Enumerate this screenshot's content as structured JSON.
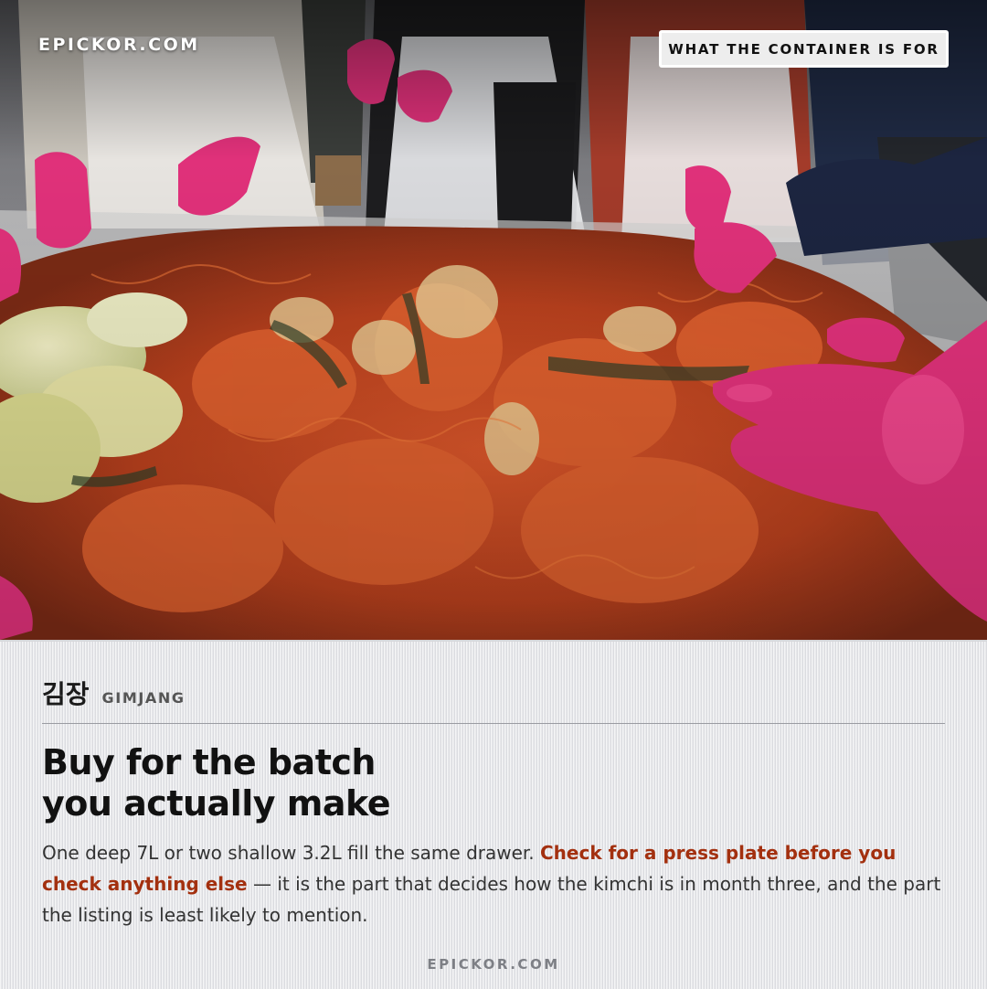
{
  "header": {
    "brand": "EPICKOR.COM",
    "badge": "WHAT THE CONTAINER IS FOR"
  },
  "article": {
    "kicker_ko": "김장",
    "kicker_en": "GIMJANG",
    "headline_line1": "Buy for the batch",
    "headline_line2": "you actually make",
    "body_part1": "One deep 7L or two shallow 3.2L fill the same drawer. ",
    "body_highlight": "Check for a press plate before you check anything else",
    "body_part2": " — it is the part that decides how the kimchi is in month three, and the part the listing is least likely to mention."
  },
  "footer": {
    "brand": "EPICKOR.COM"
  },
  "colors": {
    "accent": "#a3300f",
    "glove": "#e0317a",
    "kimchi": "#c7481f"
  }
}
